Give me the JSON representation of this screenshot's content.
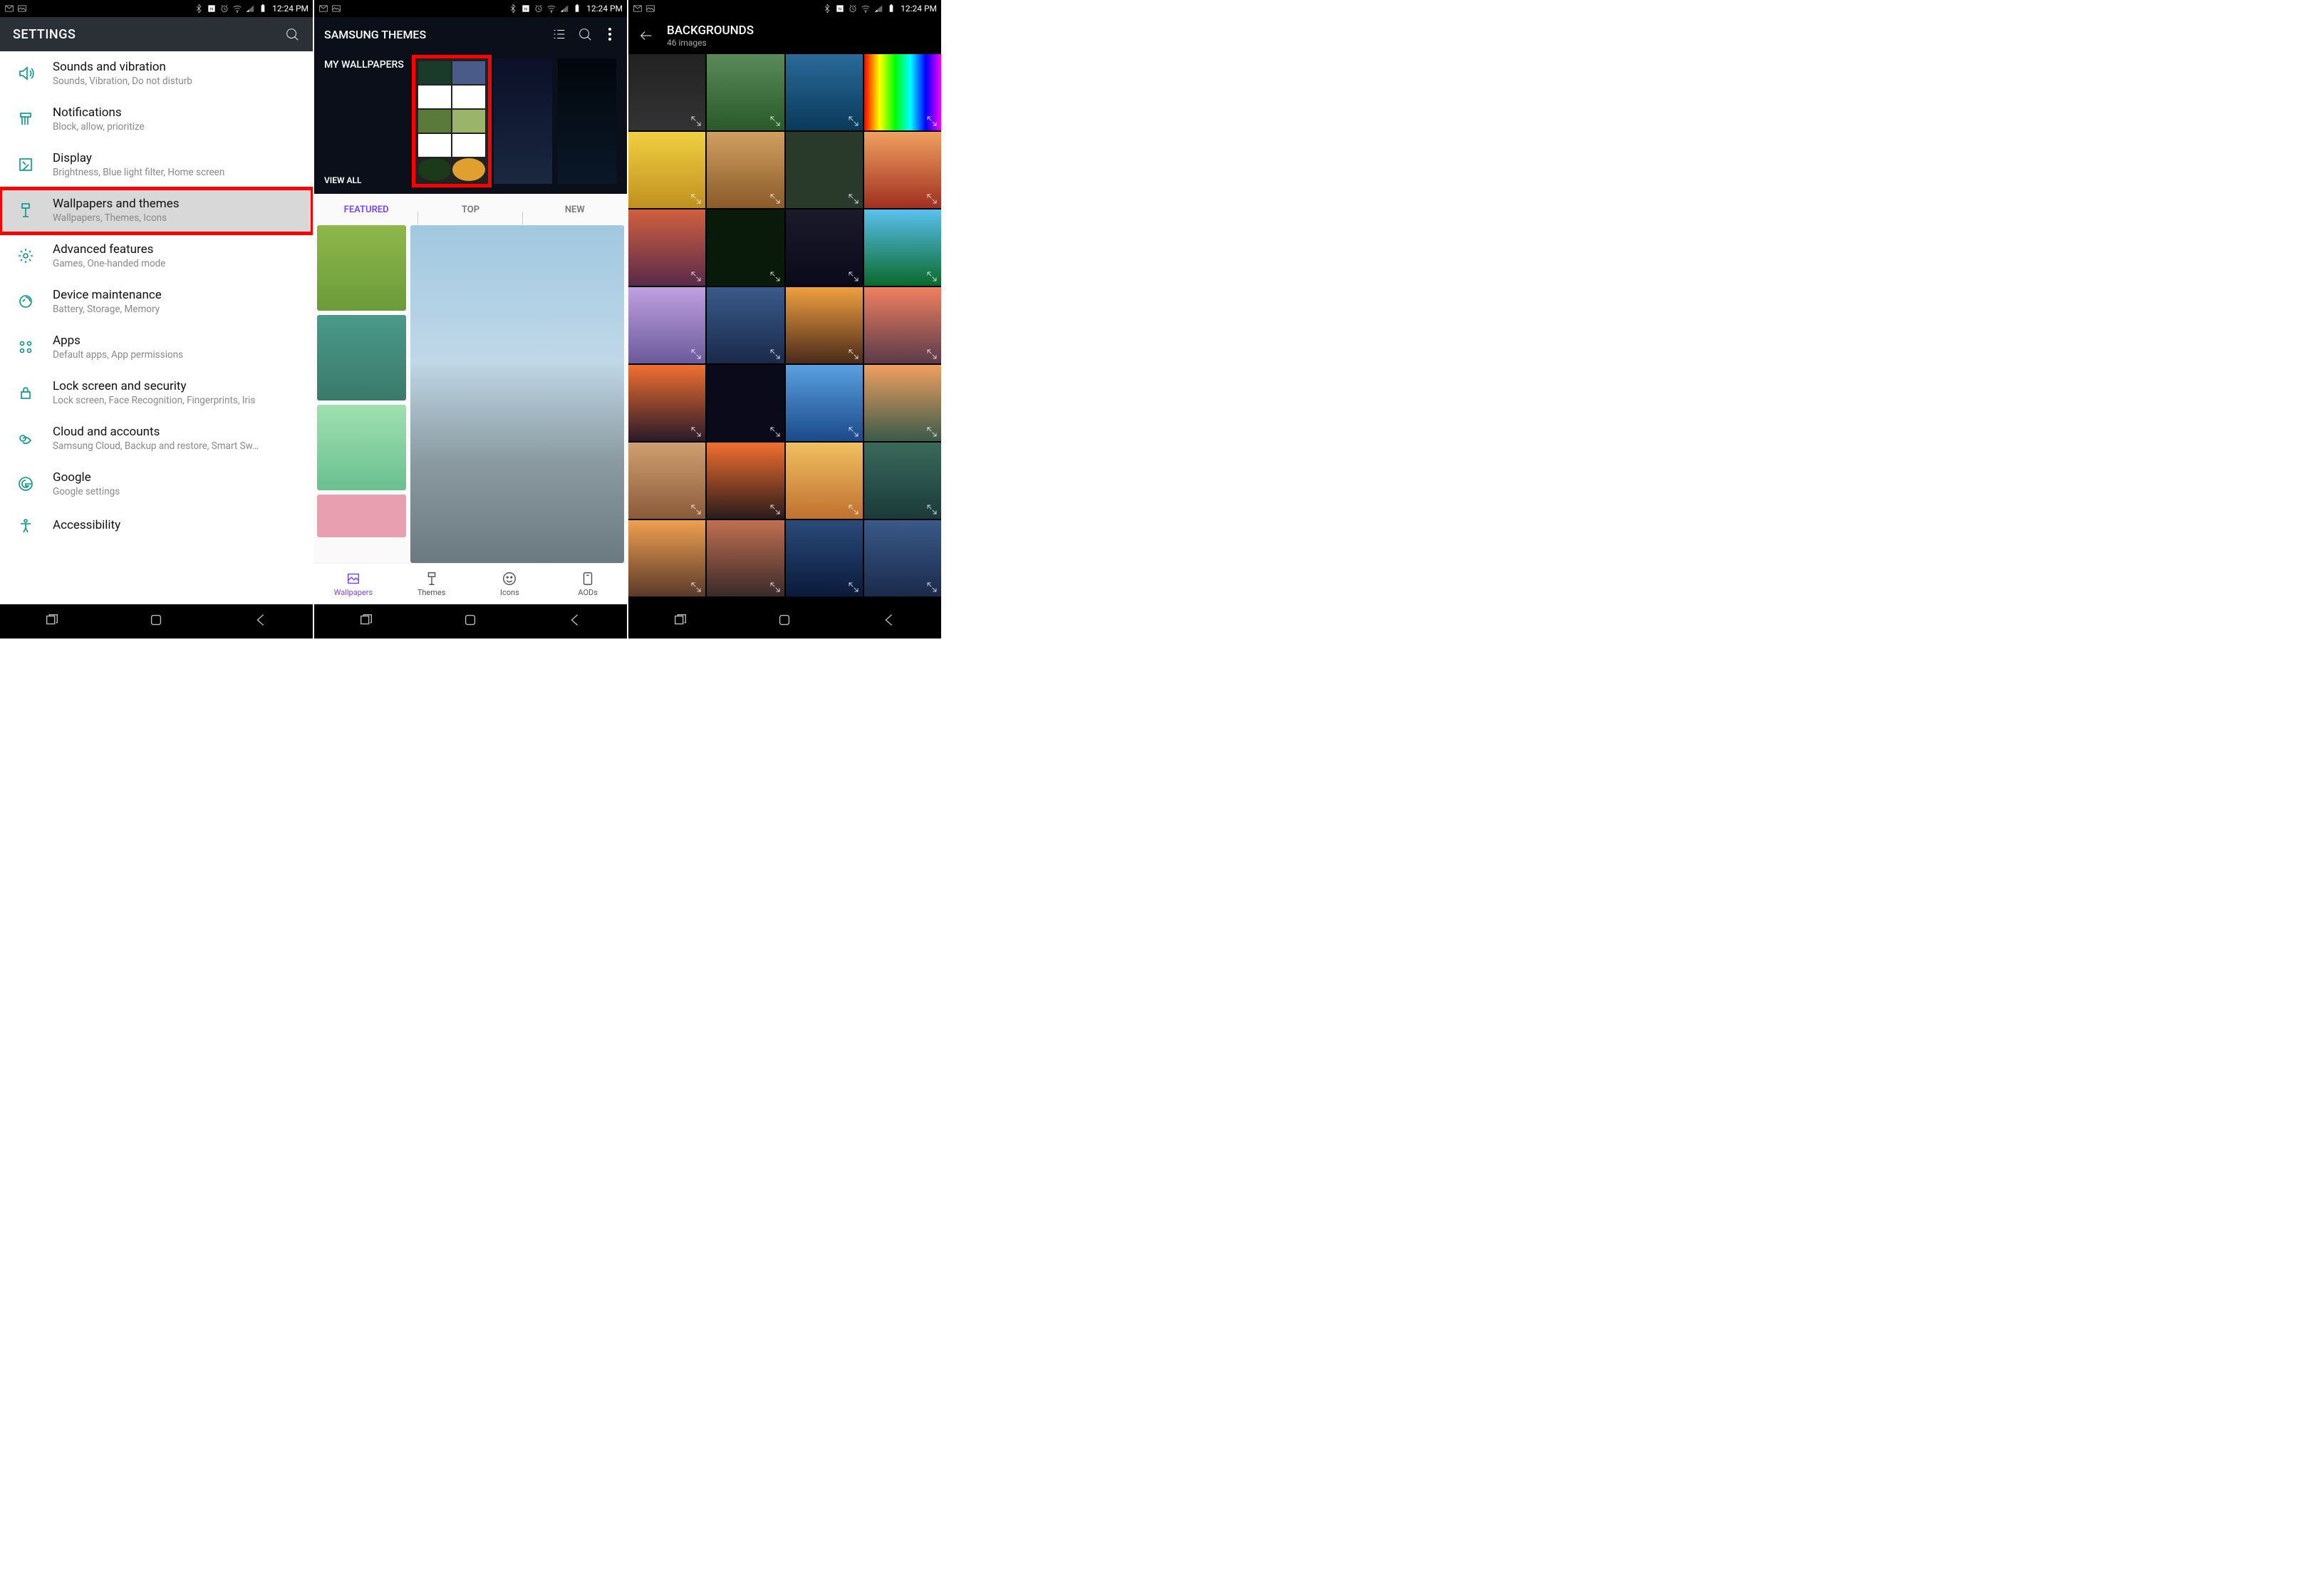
{
  "status": {
    "time": "12:24 PM"
  },
  "settings": {
    "title": "SETTINGS",
    "items": [
      {
        "label": "Sounds and vibration",
        "sub": "Sounds, Vibration, Do not disturb",
        "icon": "sound-icon",
        "highlight": false
      },
      {
        "label": "Notifications",
        "sub": "Block, allow, prioritize",
        "icon": "notifications-icon",
        "highlight": false
      },
      {
        "label": "Display",
        "sub": "Brightness, Blue light filter, Home screen",
        "icon": "display-icon",
        "highlight": false
      },
      {
        "label": "Wallpapers and themes",
        "sub": "Wallpapers, Themes, Icons",
        "icon": "wallpaper-icon",
        "highlight": true
      },
      {
        "label": "Advanced features",
        "sub": "Games, One-handed mode",
        "icon": "advanced-icon",
        "highlight": false
      },
      {
        "label": "Device maintenance",
        "sub": "Battery, Storage, Memory",
        "icon": "maintenance-icon",
        "highlight": false
      },
      {
        "label": "Apps",
        "sub": "Default apps, App permissions",
        "icon": "apps-icon",
        "highlight": false
      },
      {
        "label": "Lock screen and security",
        "sub": "Lock screen, Face Recognition, Fingerprints, Iris",
        "icon": "lock-icon",
        "highlight": false
      },
      {
        "label": "Cloud and accounts",
        "sub": "Samsung Cloud, Backup and restore, Smart Sw…",
        "icon": "cloud-icon",
        "highlight": false
      },
      {
        "label": "Google",
        "sub": "Google settings",
        "icon": "google-icon",
        "highlight": false
      },
      {
        "label": "Accessibility",
        "sub": "",
        "icon": "accessibility-icon",
        "highlight": false
      }
    ]
  },
  "themes": {
    "title": "SAMSUNG THEMES",
    "my_wallpapers_label": "MY WALLPAPERS",
    "view_all_label": "VIEW ALL",
    "tabs": [
      {
        "label": "FEATURED",
        "active": true
      },
      {
        "label": "TOP",
        "active": false
      },
      {
        "label": "NEW",
        "active": false
      }
    ],
    "bottom_nav": [
      {
        "label": "Wallpapers",
        "icon": "wallpapers-icon",
        "active": true
      },
      {
        "label": "Themes",
        "icon": "themes-icon",
        "active": false
      },
      {
        "label": "Icons",
        "icon": "icons-icon",
        "active": false
      },
      {
        "label": "AODs",
        "icon": "aods-icon",
        "active": false
      }
    ]
  },
  "backgrounds": {
    "title": "BACKGROUNDS",
    "subtitle": "46 images",
    "grid_count": 28
  },
  "navbar": {
    "recent": "recent-apps-button",
    "home": "home-button",
    "back": "back-button"
  }
}
